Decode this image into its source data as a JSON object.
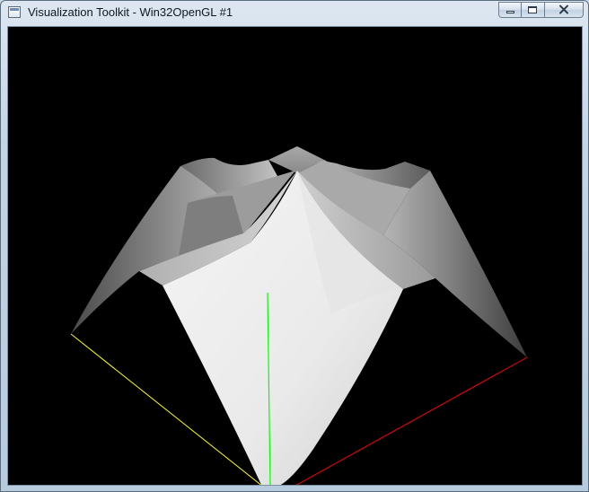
{
  "window": {
    "title": "Visualization Toolkit - Win32OpenGL #1",
    "icon": "vtk-window-icon",
    "buttons": {
      "minimize": "minimize-icon",
      "maximize": "maximize-icon",
      "close": "close-icon"
    }
  },
  "render": {
    "background": "#000000",
    "surface_color": "#e8e8e8",
    "axes": {
      "x_color": "#ff0000",
      "y_color": "#00ff00",
      "z_color": "#ffff00"
    }
  }
}
